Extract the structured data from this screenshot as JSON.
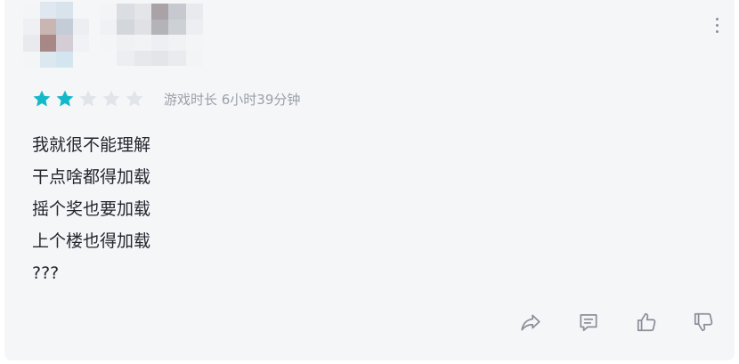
{
  "review": {
    "rating": 2,
    "rating_max": 5,
    "playtime": "游戏时长 6小时39分钟",
    "lines": [
      "我就很不能理解",
      "干点啥都得加载",
      "摇个奖也要加载",
      "上个楼也得加载",
      "???"
    ]
  },
  "icons": {
    "more": "more-vertical-icon",
    "share": "share-icon",
    "comment": "comment-icon",
    "like": "thumbs-up-icon",
    "dislike": "thumbs-down-icon",
    "star": "star-icon"
  },
  "colors": {
    "star_filled": "#14b9c8",
    "star_empty": "#e1e4e8",
    "icon_gray": "#8a8f99",
    "card_bg": "#f5f6f8"
  }
}
